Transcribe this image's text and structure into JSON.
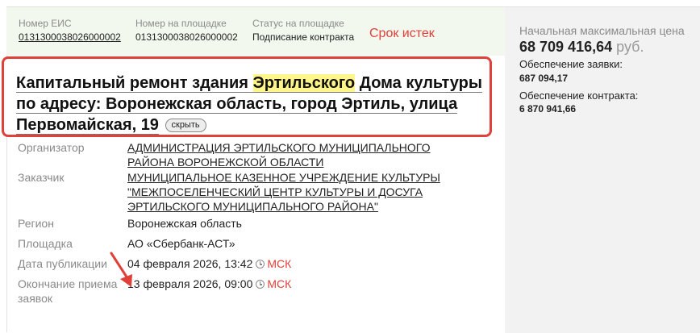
{
  "header": {
    "eis_label": "Номер ЕИС",
    "eis_value": "0131300038026000002",
    "platform_num_label": "Номер на площадке",
    "platform_num_value": "0131300038026000002",
    "status_label": "Статус на площадке",
    "status_value": "Подписание контракта",
    "expired": "Срок истек"
  },
  "title": {
    "part1": "Капитальный ремонт здания ",
    "highlight": "Эртильского",
    "part2": " Дома культуры",
    "line2": "по адресу: Воронежская область, город Эртиль, улица",
    "line3": "Первомайская, 19",
    "hide_label": "скрыть"
  },
  "details": {
    "organizer_label": "Организатор",
    "organizer_value": "АДМИНИСТРАЦИЯ ЭРТИЛЬСКОГО МУНИЦИПАЛЬНОГО РАЙОНА ВОРОНЕЖСКОЙ ОБЛАСТИ",
    "customer_label": "Заказчик",
    "customer_value": "МУНИЦИПАЛЬНОЕ КАЗЕННОЕ УЧРЕЖДЕНИЕ КУЛЬТУРЫ \"МЕЖПОСЕЛЕНЧЕСКИЙ ЦЕНТР КУЛЬТУРЫ И ДОСУГА ЭРТИЛЬСКОГО МУНИЦИПАЛЬНОГО РАЙОНА\"",
    "region_label": "Регион",
    "region_value": "Воронежская область",
    "platform_label": "Площадка",
    "platform_value": "АО «Сбербанк-АСТ»",
    "pub_label": "Дата публикации",
    "pub_value": "04 февраля 2026, 13:42",
    "end_label": "Окончание приема заявок",
    "end_value": "13 февраля 2026, 09:00",
    "tz": "МСК"
  },
  "sidebar": {
    "price_label": "Начальная максимальная цена",
    "price_value": "68 709 416,64",
    "currency": "руб.",
    "bid_sec_label": "Обеспечение заявки:",
    "bid_sec_value": "687 094,17",
    "contract_sec_label": "Обеспечение контракта:",
    "contract_sec_value": "6 870 941,66"
  },
  "colors": {
    "accent_red": "#e0403a",
    "highlight": "#fff58a",
    "band": "#f2f8ee"
  },
  "icons": [
    "clock-icon",
    "red-arrow-annotation"
  ]
}
